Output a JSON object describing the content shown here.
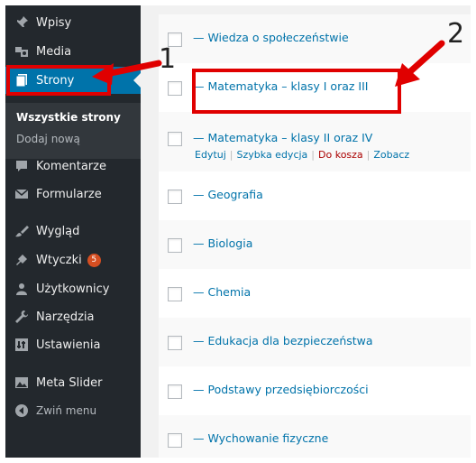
{
  "sidebar": {
    "items": [
      {
        "label": "Wpisy",
        "icon": "pin-icon"
      },
      {
        "label": "Media",
        "icon": "media-icon"
      },
      {
        "label": "Strony",
        "icon": "pages-icon"
      },
      {
        "label": "Komentarze",
        "icon": "comment-icon"
      },
      {
        "label": "Formularze",
        "icon": "mail-icon"
      },
      {
        "label": "Wygląd",
        "icon": "brush-icon"
      },
      {
        "label": "Wtyczki",
        "icon": "plugin-icon",
        "badge": "5"
      },
      {
        "label": "Użytkownicy",
        "icon": "user-icon"
      },
      {
        "label": "Narzędzia",
        "icon": "wrench-icon"
      },
      {
        "label": "Ustawienia",
        "icon": "settings-icon"
      },
      {
        "label": "Meta Slider",
        "icon": "slider-icon"
      },
      {
        "label": "Zwiń menu",
        "icon": "collapse-icon"
      }
    ],
    "submenu": {
      "all_pages": "Wszystkie strony",
      "add_new": "Dodaj nową"
    }
  },
  "pages": [
    {
      "title": "— Wiedza o społeczeństwie"
    },
    {
      "title": "— Matematyka – klasy I oraz III"
    },
    {
      "title": "— Matematyka – klasy II oraz IV"
    },
    {
      "title": "— Geografia"
    },
    {
      "title": "— Biologia"
    },
    {
      "title": "— Chemia"
    },
    {
      "title": "— Edukacja dla bezpieczeństwa"
    },
    {
      "title": "— Podstawy przedsiębiorczości"
    },
    {
      "title": "— Wychowanie fizyczne"
    }
  ],
  "row_actions": {
    "edit": "Edytuj",
    "quick_edit": "Szybka edycja",
    "trash": "Do kosza",
    "view": "Zobacz"
  },
  "annotations": {
    "label_1": "1",
    "label_2": "2",
    "color": "#e00000"
  },
  "colors": {
    "sidebar_bg": "#23282d",
    "active_bg": "#0073aa",
    "link": "#0073aa",
    "badge": "#d54e21"
  }
}
